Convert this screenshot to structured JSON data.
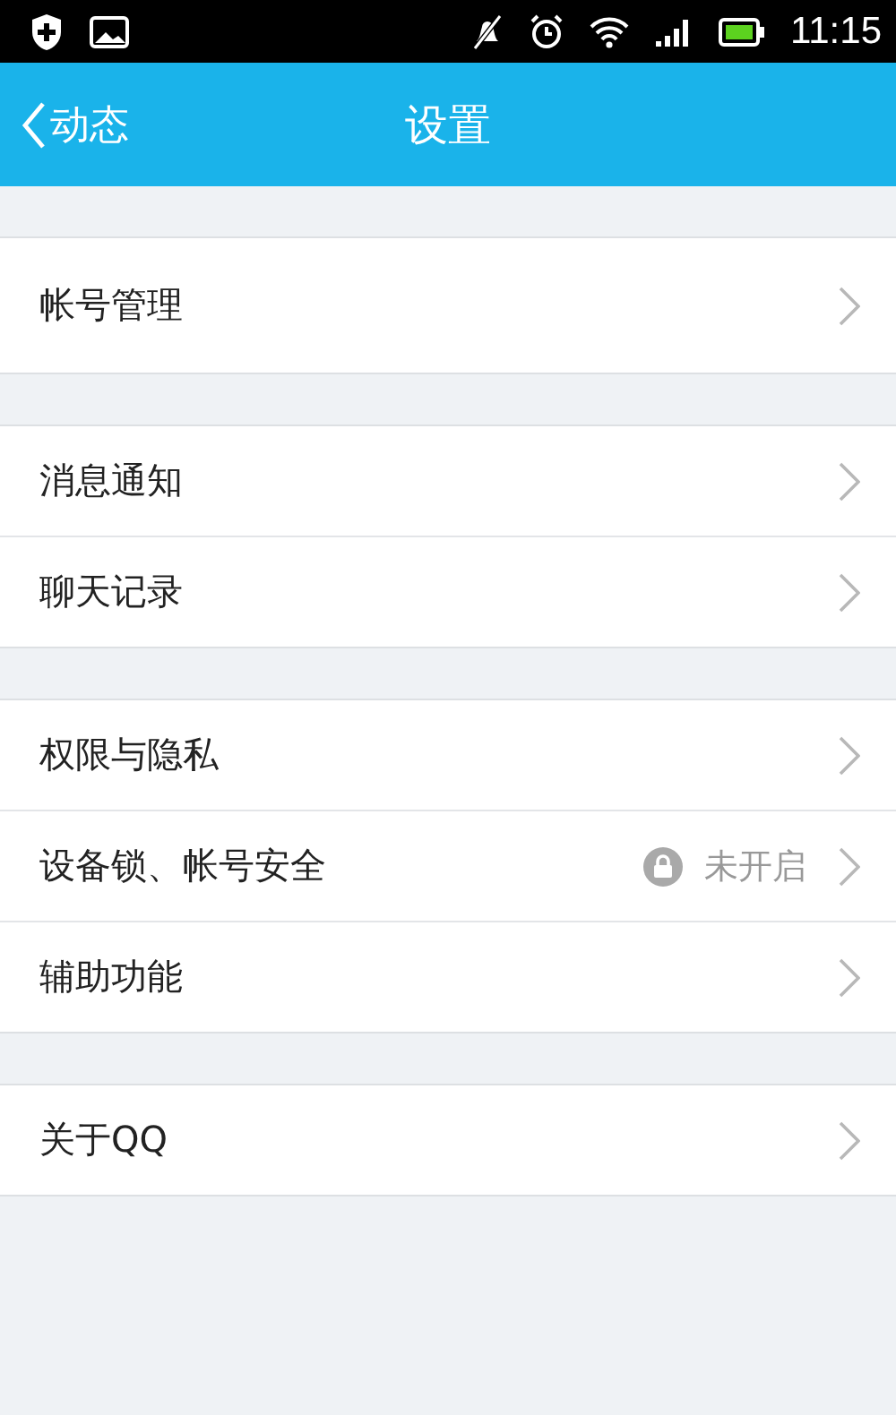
{
  "status_bar": {
    "time": "11:15"
  },
  "header": {
    "back": "动态",
    "title": "设置"
  },
  "groups": [
    {
      "items": [
        {
          "kind": "tall",
          "label": "帐号管理"
        }
      ]
    },
    {
      "items": [
        {
          "kind": "plain",
          "label": "消息通知"
        },
        {
          "kind": "plain",
          "label": "聊天记录"
        }
      ]
    },
    {
      "items": [
        {
          "kind": "plain",
          "label": "权限与隐私"
        },
        {
          "kind": "status",
          "label": "设备锁、帐号安全",
          "status": "未开启"
        },
        {
          "kind": "plain",
          "label": "辅助功能"
        }
      ]
    },
    {
      "items": [
        {
          "kind": "plain",
          "label": "关于QQ"
        }
      ]
    }
  ]
}
